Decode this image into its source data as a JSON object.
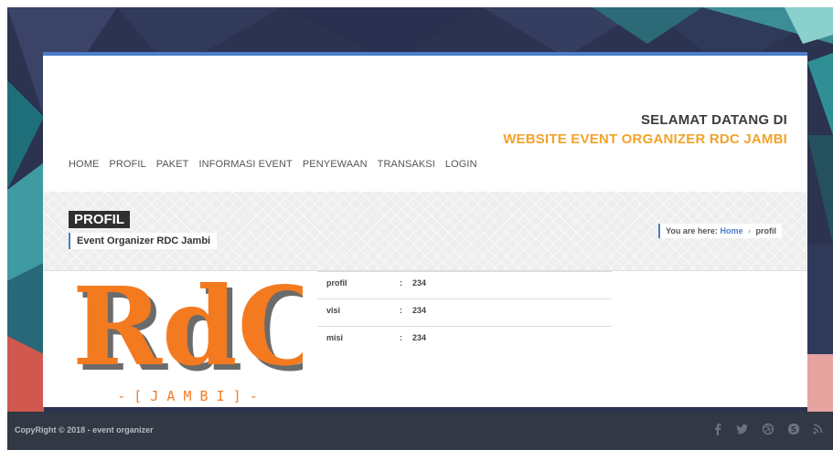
{
  "header": {
    "welcome_line1": "SELAMAT DATANG DI",
    "welcome_line2": "WEBSITE EVENT ORGANIZER RDC JAMBI"
  },
  "nav": [
    "HOME",
    "PROFIL",
    "PAKET",
    "INFORMASI EVENT",
    "PENYEWAAN",
    "TRANSAKSI",
    "LOGIN"
  ],
  "page": {
    "title": "PROFIL",
    "subtitle": "Event Organizer RDC Jambi"
  },
  "breadcrumb": {
    "prefix": "You are here:",
    "home": "Home",
    "separator": "›",
    "current": "profil"
  },
  "logo": {
    "text": "RdC",
    "subtext": "- [ J A M B I ] -"
  },
  "info_rows": [
    {
      "key": "profil",
      "colon": ":",
      "value": "234"
    },
    {
      "key": "visi",
      "colon": ":",
      "value": "234"
    },
    {
      "key": "misi",
      "colon": ":",
      "value": "234"
    }
  ],
  "footer": {
    "copyright": "CopyRight © 2018 - event organizer",
    "social_icons": [
      "facebook-icon",
      "twitter-icon",
      "dribbble-icon",
      "skype-icon",
      "rss-icon"
    ]
  },
  "colors": {
    "accent_blue": "#4c7ec9",
    "accent_orange": "#f2a32c",
    "footer_bg": "#323844",
    "logo_orange": "#f47a20",
    "logo_gray": "#6b6b6b"
  }
}
